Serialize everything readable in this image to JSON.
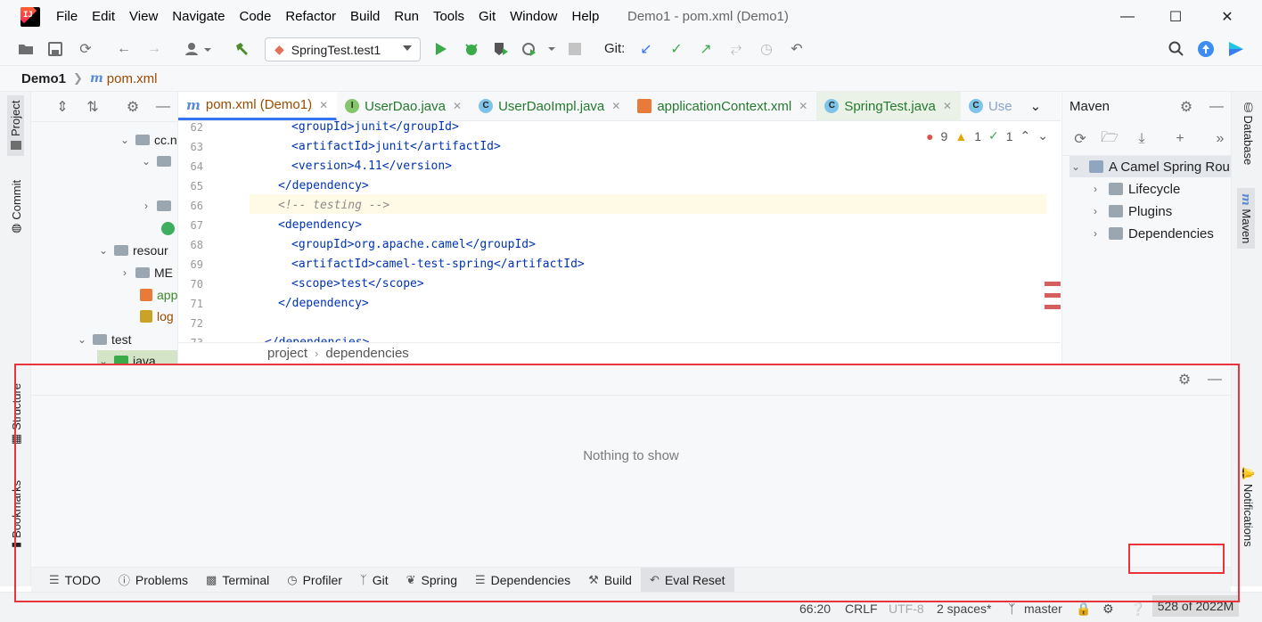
{
  "app": {
    "title": "Demo1 - pom.xml (Demo1)"
  },
  "menu": [
    "File",
    "Edit",
    "View",
    "Navigate",
    "Code",
    "Refactor",
    "Build",
    "Run",
    "Tools",
    "Git",
    "Window",
    "Help"
  ],
  "toolbar": {
    "run_config": "SpringTest.test1",
    "git_label": "Git:"
  },
  "breadcrumb": {
    "project": "Demo1",
    "file": "pom.xml"
  },
  "left_stripe": {
    "project": "Project",
    "commit": "Commit",
    "structure": "Structure",
    "bookmarks": "Bookmarks"
  },
  "right_stripe": {
    "database": "Database",
    "maven": "Maven",
    "notifications": "Notifications"
  },
  "project_tree": [
    {
      "label": "cc.n"
    },
    {
      "label": "resour"
    },
    {
      "label": "ME"
    },
    {
      "label": "app"
    },
    {
      "label": "log"
    },
    {
      "label": "test"
    },
    {
      "label": "java"
    }
  ],
  "editor_tabs": [
    {
      "label": "pom.xml (Demo1)",
      "icon": "m"
    },
    {
      "label": "UserDao.java",
      "icon": "I"
    },
    {
      "label": "UserDaoImpl.java",
      "icon": "C"
    },
    {
      "label": "applicationContext.xml",
      "icon": "xml"
    },
    {
      "label": "SpringTest.java",
      "icon": "C"
    },
    {
      "label": "Use",
      "icon": "C"
    }
  ],
  "editor": {
    "lines": [
      {
        "num": "62",
        "text": "<groupId>junit</groupId>"
      },
      {
        "num": "63",
        "text": "<artifactId>junit</artifactId>"
      },
      {
        "num": "64",
        "text": "<version>4.11</version>"
      },
      {
        "num": "65",
        "text": "</dependency>"
      },
      {
        "num": "66",
        "text": "<!-- testing -->"
      },
      {
        "num": "67",
        "text": "<dependency>"
      },
      {
        "num": "68",
        "text": "<groupId>org.apache.camel</groupId>"
      },
      {
        "num": "69",
        "text": "<artifactId>camel-test-spring</artifactId>"
      },
      {
        "num": "70",
        "text": "<scope>test</scope>"
      },
      {
        "num": "71",
        "text": "</dependency>"
      },
      {
        "num": "72",
        "text": ""
      },
      {
        "num": "73",
        "text": "</dependencies>"
      }
    ],
    "errors": "9",
    "warnings": "1",
    "weak_warnings": "1",
    "crumb1": "project",
    "crumb2": "dependencies"
  },
  "maven": {
    "title": "Maven",
    "project": "A Camel Spring Rou",
    "nodes": [
      "Lifecycle",
      "Plugins",
      "Dependencies"
    ]
  },
  "bottom_panel": {
    "empty_message": "Nothing to show"
  },
  "bottom_tabs": [
    "TODO",
    "Problems",
    "Terminal",
    "Profiler",
    "Git",
    "Spring",
    "Dependencies",
    "Build",
    "Eval Reset"
  ],
  "status": {
    "position": "66:20",
    "line_sep": "CRLF",
    "encoding": "UTF-8",
    "indent": "2 spaces*",
    "branch": "master",
    "memory": "528 of 2022M"
  },
  "colors": {
    "accent": "#3574f0",
    "annotation": "#e8343a"
  }
}
